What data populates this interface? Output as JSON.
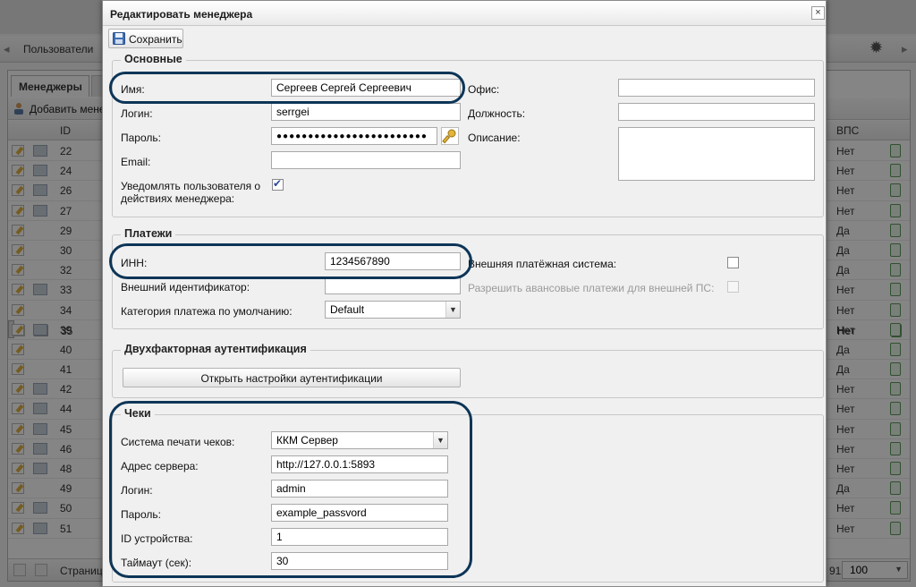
{
  "background": {
    "nav_text": "Пользователи",
    "tab_label": "Менеджеры",
    "add_button_label": "Добавить мене",
    "col_id": "ID",
    "col_vps": "ВПС",
    "rows": [
      {
        "id": "22",
        "vps": "Нет",
        "card": true
      },
      {
        "id": "24",
        "vps": "Нет",
        "card": true
      },
      {
        "id": "26",
        "vps": "Нет",
        "card": true
      },
      {
        "id": "27",
        "vps": "Нет",
        "card": true
      },
      {
        "id": "29",
        "vps": "Да",
        "card": false
      },
      {
        "id": "30",
        "vps": "Да",
        "card": false
      },
      {
        "id": "32",
        "vps": "Да",
        "card": false
      },
      {
        "id": "33",
        "vps": "Нет",
        "card": true
      },
      {
        "id": "34",
        "vps": "Нет",
        "card": false
      },
      {
        "id": "35",
        "vps": "Нет",
        "card": true,
        "selected": true
      },
      {
        "id": "39",
        "vps": "Нет",
        "card": true
      },
      {
        "id": "40",
        "vps": "Да",
        "card": false
      },
      {
        "id": "41",
        "vps": "Да",
        "card": false
      },
      {
        "id": "42",
        "vps": "Нет",
        "card": true
      },
      {
        "id": "44",
        "vps": "Нет",
        "card": true
      },
      {
        "id": "45",
        "vps": "Нет",
        "card": true
      },
      {
        "id": "46",
        "vps": "Нет",
        "card": true
      },
      {
        "id": "48",
        "vps": "Нет",
        "card": true
      },
      {
        "id": "49",
        "vps": "Да",
        "card": false
      },
      {
        "id": "50",
        "vps": "Нет",
        "card": true
      },
      {
        "id": "51",
        "vps": "Нет",
        "card": true
      }
    ],
    "pager_text": "Страниц",
    "pager_total": "91",
    "page_size": "100"
  },
  "dialog": {
    "title": "Редактировать менеджера",
    "close_glyph": "×",
    "save_label": "Сохранить",
    "basic": {
      "legend": "Основные",
      "name_label": "Имя:",
      "name_value": "Сергеев Сергей Сергеевич",
      "login_label": "Логин:",
      "login_value": "serrgei",
      "password_label": "Пароль:",
      "password_value": "●●●●●●●●●●●●●●●●●●●●●●●●",
      "email_label": "Email:",
      "email_value": "",
      "notify_label_1": "Уведомлять пользователя о",
      "notify_label_2": "действиях менеджера:",
      "notify_checked": true,
      "office_label": "Офис:",
      "office_value": "",
      "position_label": "Должность:",
      "position_value": "",
      "description_label": "Описание:",
      "description_value": ""
    },
    "payments": {
      "legend": "Платежи",
      "inn_label": "ИНН:",
      "inn_value": "1234567890",
      "ext_id_label": "Внешний идентификатор:",
      "ext_id_value": "",
      "category_label": "Категория платежа по умолчанию:",
      "category_value": "Default",
      "ext_system_label": "Внешняя платёжная система:",
      "ext_system_checked": false,
      "allow_advance_label": "Разрешить авансовые платежи для внешней ПС:",
      "allow_advance_checked": false
    },
    "twofa": {
      "legend": "Двухфакторная аутентификация",
      "open_button_label": "Открыть настройки аутентификации"
    },
    "receipts": {
      "legend": "Чеки",
      "system_label": "Система печати чеков:",
      "system_value": "ККМ Сервер",
      "server_label": "Адрес сервера:",
      "server_value": "http://127.0.0.1:5893",
      "login_label": "Логин:",
      "login_value": "admin",
      "password_label": "Пароль:",
      "password_value": "example_passvord",
      "device_label": "ID устройства:",
      "device_value": "1",
      "timeout_label": "Таймаут (сек):",
      "timeout_value": "30"
    }
  },
  "colors": {
    "highlight": "#0d3557",
    "dialog_bg": "#f0f0f0"
  }
}
